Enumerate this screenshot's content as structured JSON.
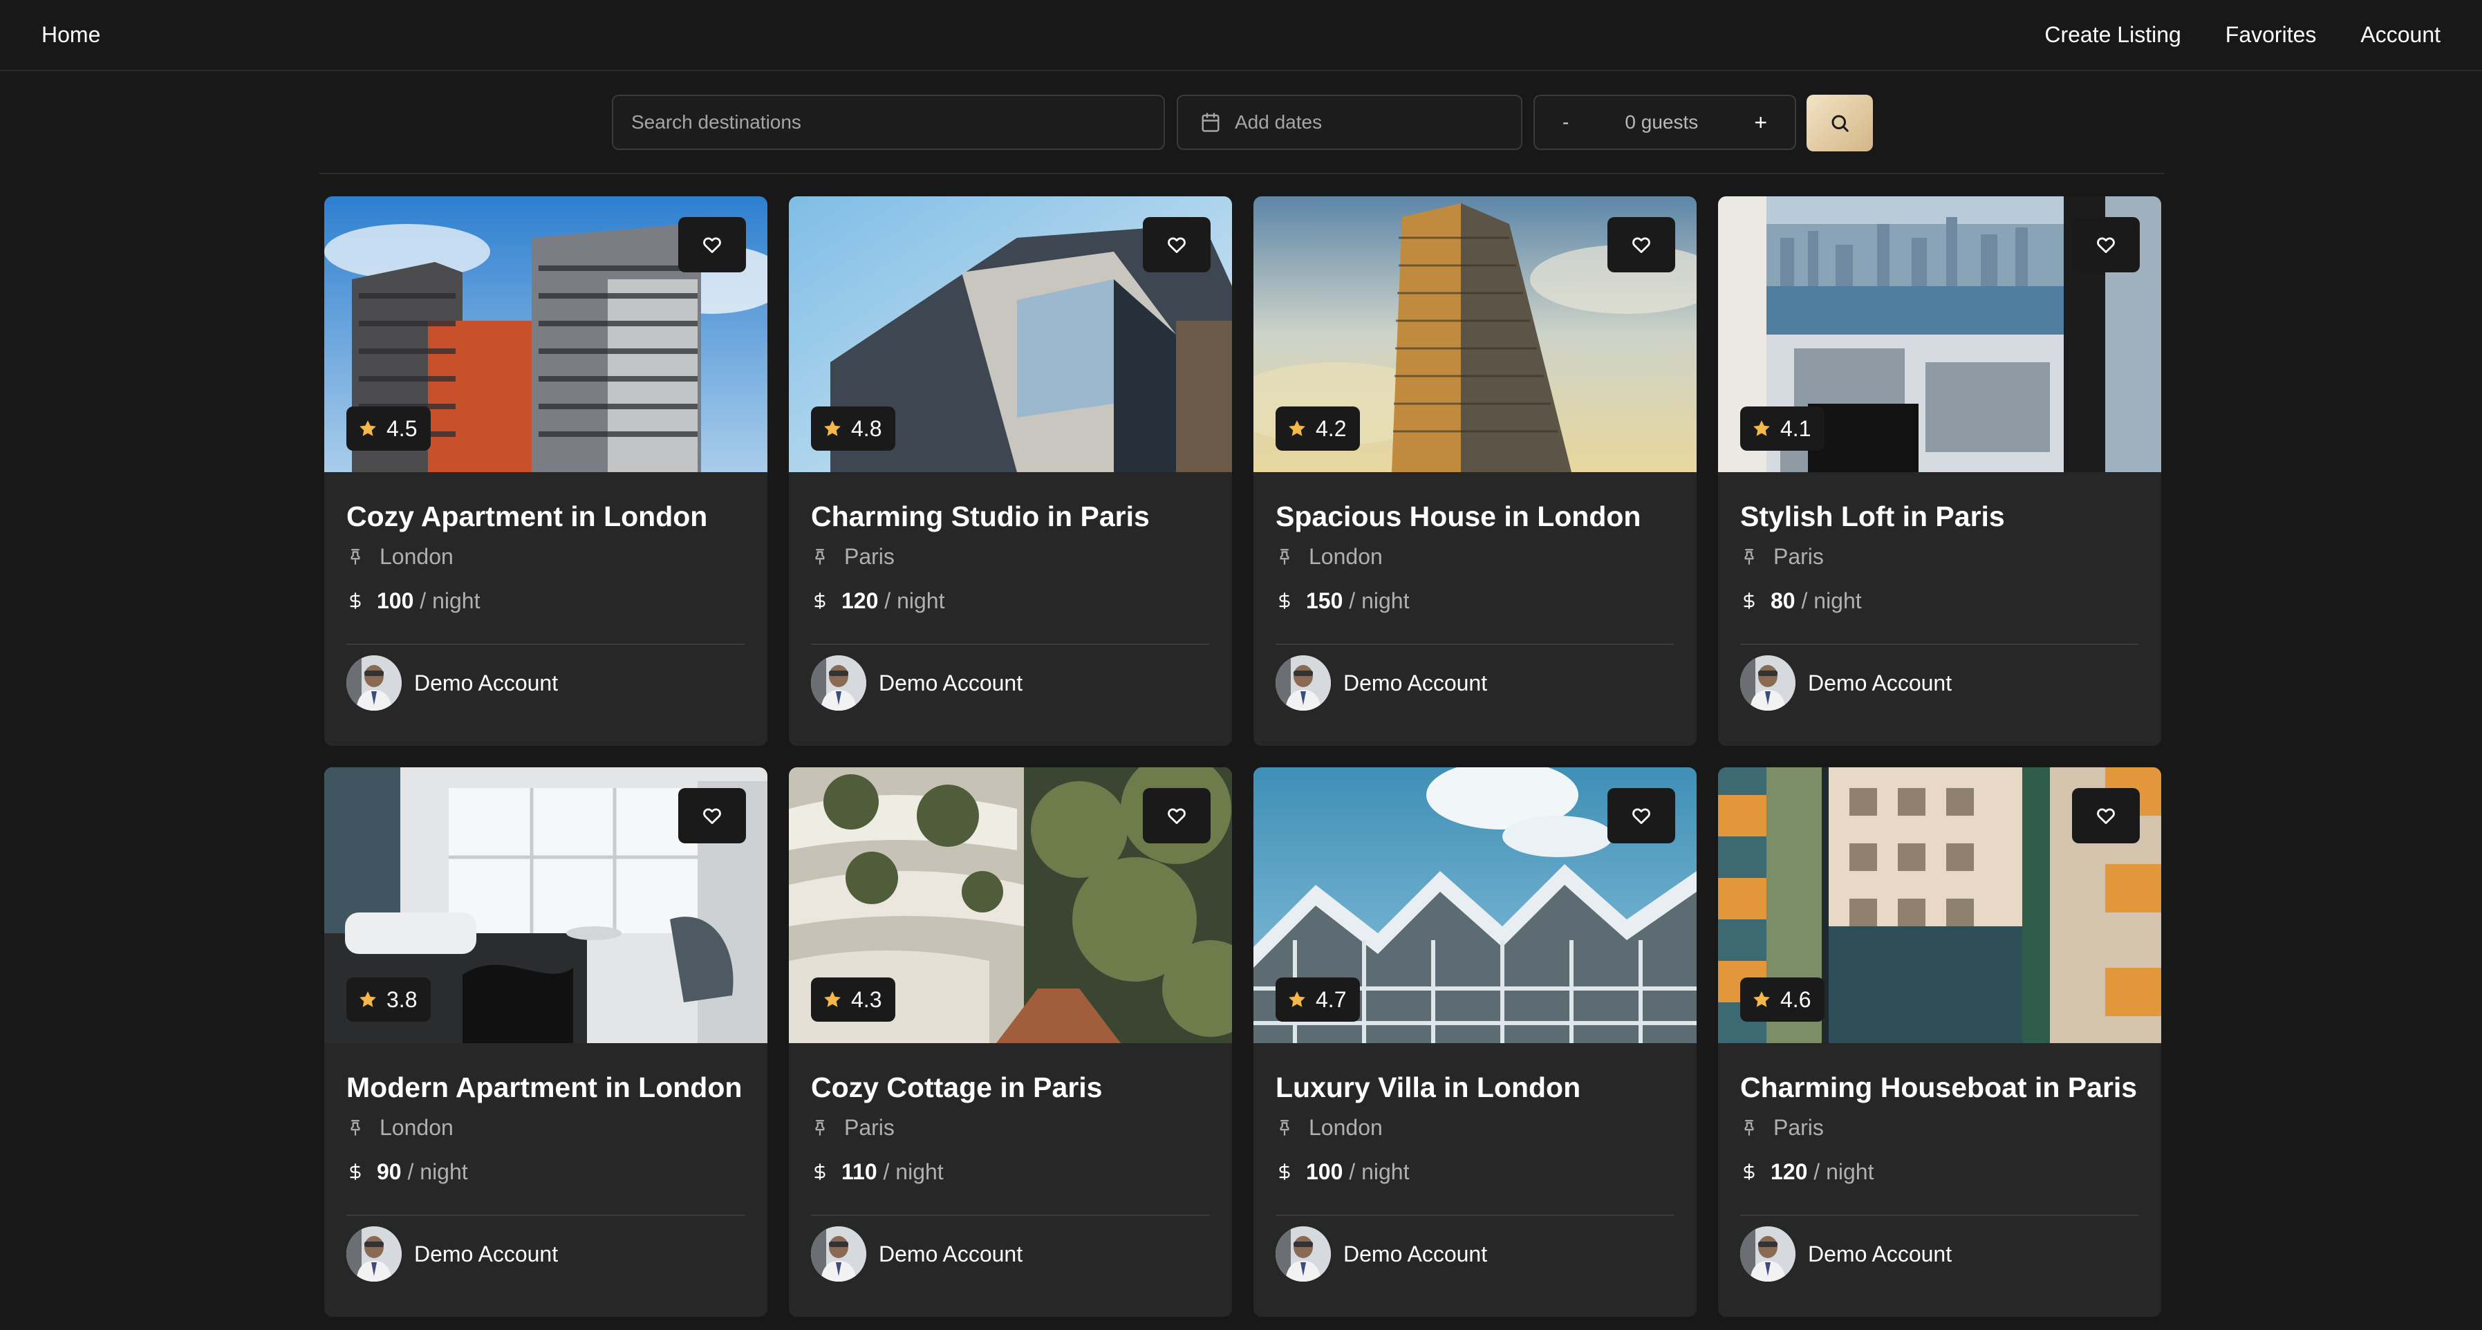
{
  "nav": {
    "home": "Home",
    "links": [
      "Create Listing",
      "Favorites",
      "Account"
    ]
  },
  "search": {
    "destination_placeholder": "Search destinations",
    "dates_label": "Add dates",
    "guests_minus": "-",
    "guests_label": "0 guests",
    "guests_plus": "+",
    "search_icon": "search-icon"
  },
  "colors": {
    "background": "#181818",
    "card": "#272727",
    "star": "#f5b74a",
    "search_button": "#e8cfa0"
  },
  "listings": [
    {
      "title": "Cozy Apartment in London",
      "location": "London",
      "price": "100",
      "per": "/ night",
      "rating": "4.5",
      "host": "Demo Account",
      "photo": "apartment-towers-orange"
    },
    {
      "title": "Charming Studio in Paris",
      "location": "Paris",
      "price": "120",
      "per": "/ night",
      "rating": "4.8",
      "host": "Demo Account",
      "photo": "modern-building-corner"
    },
    {
      "title": "Spacious House in London",
      "location": "London",
      "price": "150",
      "per": "/ night",
      "rating": "4.2",
      "host": "Demo Account",
      "photo": "tall-tower-sunset"
    },
    {
      "title": "Stylish Loft in Paris",
      "location": "Paris",
      "price": "80",
      "per": "/ night",
      "rating": "4.1",
      "host": "Demo Account",
      "photo": "harbor-city-view"
    },
    {
      "title": "Modern Apartment in London",
      "location": "London",
      "price": "90",
      "per": "/ night",
      "rating": "3.8",
      "host": "Demo Account",
      "photo": "bedroom-interior"
    },
    {
      "title": "Cozy Cottage in Paris",
      "location": "Paris",
      "price": "110",
      "per": "/ night",
      "rating": "4.3",
      "host": "Demo Account",
      "photo": "balconies-plants"
    },
    {
      "title": "Luxury Villa in London",
      "location": "London",
      "price": "100",
      "per": "/ night",
      "rating": "4.7",
      "host": "Demo Account",
      "photo": "zigzag-facade-sky"
    },
    {
      "title": "Charming Houseboat in Paris",
      "location": "Paris",
      "price": "120",
      "per": "/ night",
      "rating": "4.6",
      "host": "Demo Account",
      "photo": "colorful-blocks"
    }
  ]
}
